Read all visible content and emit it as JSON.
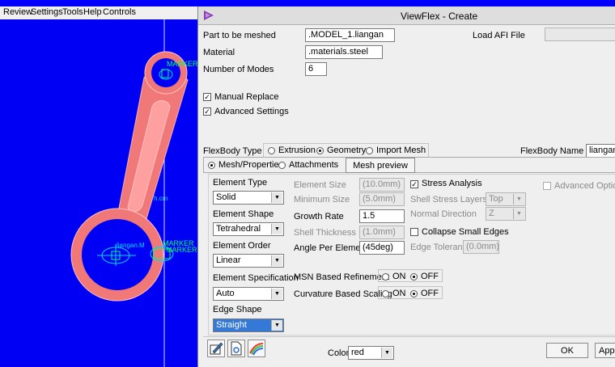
{
  "menu": {
    "items": [
      "Review",
      "Settings",
      "Tools",
      "Help",
      "Controls"
    ],
    "underline": [
      "R",
      "S",
      "T",
      "H",
      "C"
    ]
  },
  "viewport": {
    "markers": [
      "MARKER",
      "MARKER",
      "MARKER"
    ],
    "labels": [
      "liangan.M",
      "h.cm"
    ]
  },
  "dialog": {
    "title": "ViewFlex - Create",
    "part_label": "Part to be meshed",
    "part_value": ".MODEL_1.liangan",
    "load_afi_label": "Load AFI File",
    "material_label": "Material",
    "material_value": ".materials.steel",
    "modes_label": "Number of Modes",
    "modes_value": "6",
    "manual_replace_label": "Manual Replace",
    "advanced_settings_label": "Advanced Settings",
    "flexbody_type_label": "FlexBody Type",
    "type_extrusion": "Extrusion",
    "type_geometry": "Geometry",
    "type_import_mesh": "Import Mesh",
    "flexbody_name_label": "FlexBody Name",
    "flexbody_name_value": "liangan_",
    "tab_mesh_properties": "Mesh/Properties",
    "tab_attachments": "Attachments",
    "mesh_preview": "Mesh preview",
    "element_type_label": "Element Type",
    "element_type_value": "Solid",
    "element_shape_label": "Element Shape",
    "element_shape_value": "Tetrahedral",
    "element_order_label": "Element Order",
    "element_order_value": "Linear",
    "element_spec_label": "Element Specification",
    "element_spec_value": "Auto",
    "edge_shape_label": "Edge Shape",
    "edge_shape_value": "Straight",
    "element_size_label": "Element Size",
    "element_size_value": "(10.0mm)",
    "min_size_label": "Minimum Size",
    "min_size_value": "(5.0mm)",
    "growth_rate_label": "Growth Rate",
    "growth_rate_value": "1.5",
    "shell_thickness_label": "Shell Thickness",
    "shell_thickness_value": "(1.0mm)",
    "angle_label": "Angle Per Element",
    "angle_value": "(45deg)",
    "stress_label": "Stress Analysis",
    "shell_layers_label": "Shell Stress Layers",
    "shell_layers_value": "Top",
    "normal_dir_label": "Normal Direction",
    "normal_dir_value": "Z",
    "collapse_label": "Collapse Small Edges",
    "edge_tol_label": "Edge Tolerance",
    "edge_tol_value": "(0.0mm)",
    "advanced_options_label": "Advanced Options",
    "msn_label": "MSN Based Refinement",
    "curvature_label": "Curvature Based Scaling",
    "on_label": "ON",
    "off_label": "OFF",
    "color_label": "Color",
    "color_value": "red",
    "ok_label": "OK",
    "apply_label": "App"
  },
  "colors": {
    "viewport_bg": "#0000f5",
    "part_fill": "#f08080",
    "marker_green": "#00ff66",
    "axis_cyan": "#00d8ff"
  },
  "icons": [
    "edit-icon",
    "document-icon",
    "rainbow-icon",
    "logo-icon",
    "check-icon",
    "dropdown-arrow-icon"
  ]
}
